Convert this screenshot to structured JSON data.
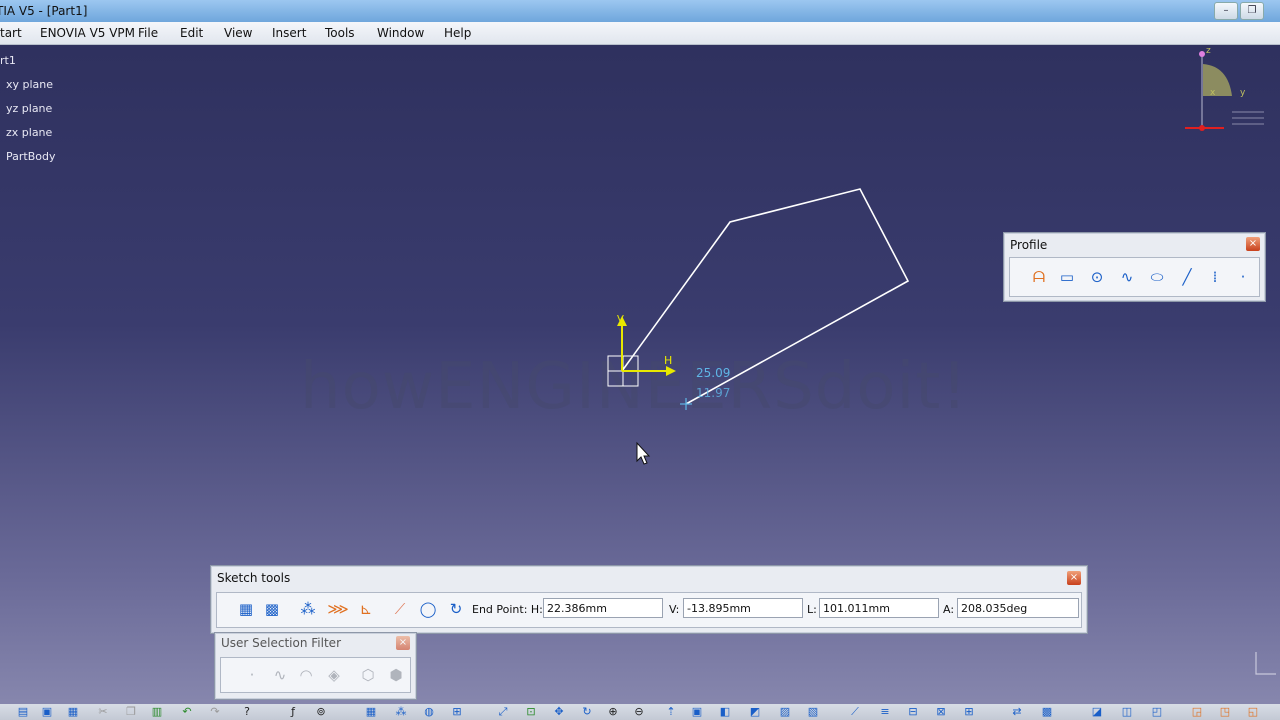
{
  "window": {
    "title": "TIA V5 - [Part1]",
    "minimize_symbol": "–",
    "restore_symbol": "❐"
  },
  "menu": {
    "items": [
      "tart",
      "ENOVIA V5 VPM",
      "File",
      "Edit",
      "View",
      "Insert",
      "Tools",
      "Window",
      "Help"
    ]
  },
  "tree": {
    "items": [
      "rt1",
      "xy plane",
      "yz plane",
      "zx plane",
      "PartBody"
    ]
  },
  "canvas": {
    "watermark": "howENGINEERSdoit!",
    "axis_v": "V",
    "axis_h": "H",
    "cursor_value_1": "25.09",
    "cursor_value_2": "11.97"
  },
  "compass": {
    "label_z": "z",
    "label_x": "x",
    "label_y": "y"
  },
  "profile_toolbar": {
    "title": "Profile",
    "close_symbol": "×",
    "tools": [
      "profile-icon",
      "rectangle-icon",
      "circle-icon",
      "spline-icon",
      "ellipse-icon",
      "line-icon",
      "axis-icon",
      "point-icon"
    ]
  },
  "sketch_tools": {
    "title": "Sketch tools",
    "close_symbol": "×",
    "end_point_label": "End Point: H:",
    "h_value": "22.386mm",
    "v_label": "V:",
    "v_value": "-13.895mm",
    "l_label": "L:",
    "l_value": "101.011mm",
    "a_label": "A:",
    "a_value": "208.035deg"
  },
  "selection_filter": {
    "title": "User Selection Filter",
    "close_symbol": "×"
  },
  "colors": {
    "sketch_line": "#ffffff",
    "axis": "#e8e800",
    "dimension": "#5fb6e6",
    "watermark": "#46486e"
  }
}
